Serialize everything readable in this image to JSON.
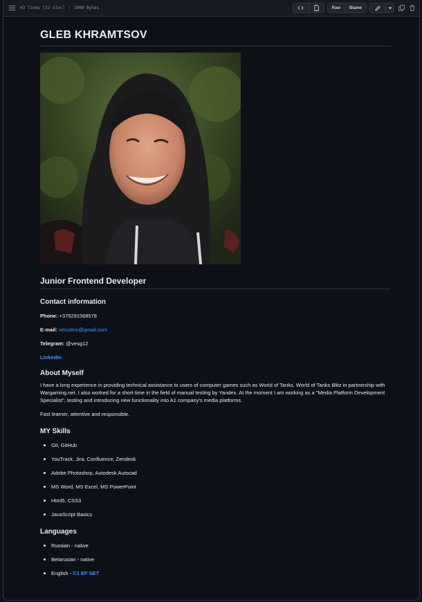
{
  "file_header": {
    "lines": "43 lines (22 sloc)",
    "size": "1008 Bytes",
    "raw_label": "Raw",
    "blame_label": "Blame",
    "icons": [
      "list-icon",
      "code-icon",
      "file-icon",
      "pencil-icon",
      "caret-down-icon",
      "copy-icon",
      "trash-icon"
    ]
  },
  "readme": {
    "name": "GLEB KHRAMTSOV",
    "photo_alt": "photo",
    "role": "Junior Frontend Developer",
    "contact": {
      "heading": "Contact information",
      "phone_label": "Phone:",
      "phone": "+375291568578",
      "email_label": "E-mail:",
      "email": "vecutem@gmail.com",
      "telegram_label": "Telegram:",
      "telegram": "@vesg12",
      "linkedin": "LinkedIn"
    },
    "about": {
      "heading": "About Myself",
      "paragraph": "I have a long experience in providing technical assistance to users of computer games such as World of Tanks, World of Tanks Blitz in partnership with Wargaming.net. I also worked for a short time in the field of manual testing by Yandex. At the moment I am working as a \"Media Platform Development Specialist\", testing and introducing new functionality into A1 company's media platforms.",
      "summary": "Fast learner, attentive and responsible."
    },
    "skills": {
      "heading": "MY Skills",
      "items": [
        "Git, GitHub",
        "YouTrack, Jira, Confluence, Zendesk",
        "Adobe Photoshop, Autodesk Autocad",
        "MS Word, MS Excel, MS PowerPoint",
        "Html5, CSS3",
        "JavaScript Basics"
      ]
    },
    "languages": {
      "heading": "Languages",
      "items": [
        "Russian - native",
        "Belarusian - native"
      ],
      "english_prefix": "English -",
      "english_level": "C1 EF SET"
    }
  },
  "colors": {
    "background": "#0d1117",
    "link": "#4493f8",
    "border": "#30363d"
  }
}
